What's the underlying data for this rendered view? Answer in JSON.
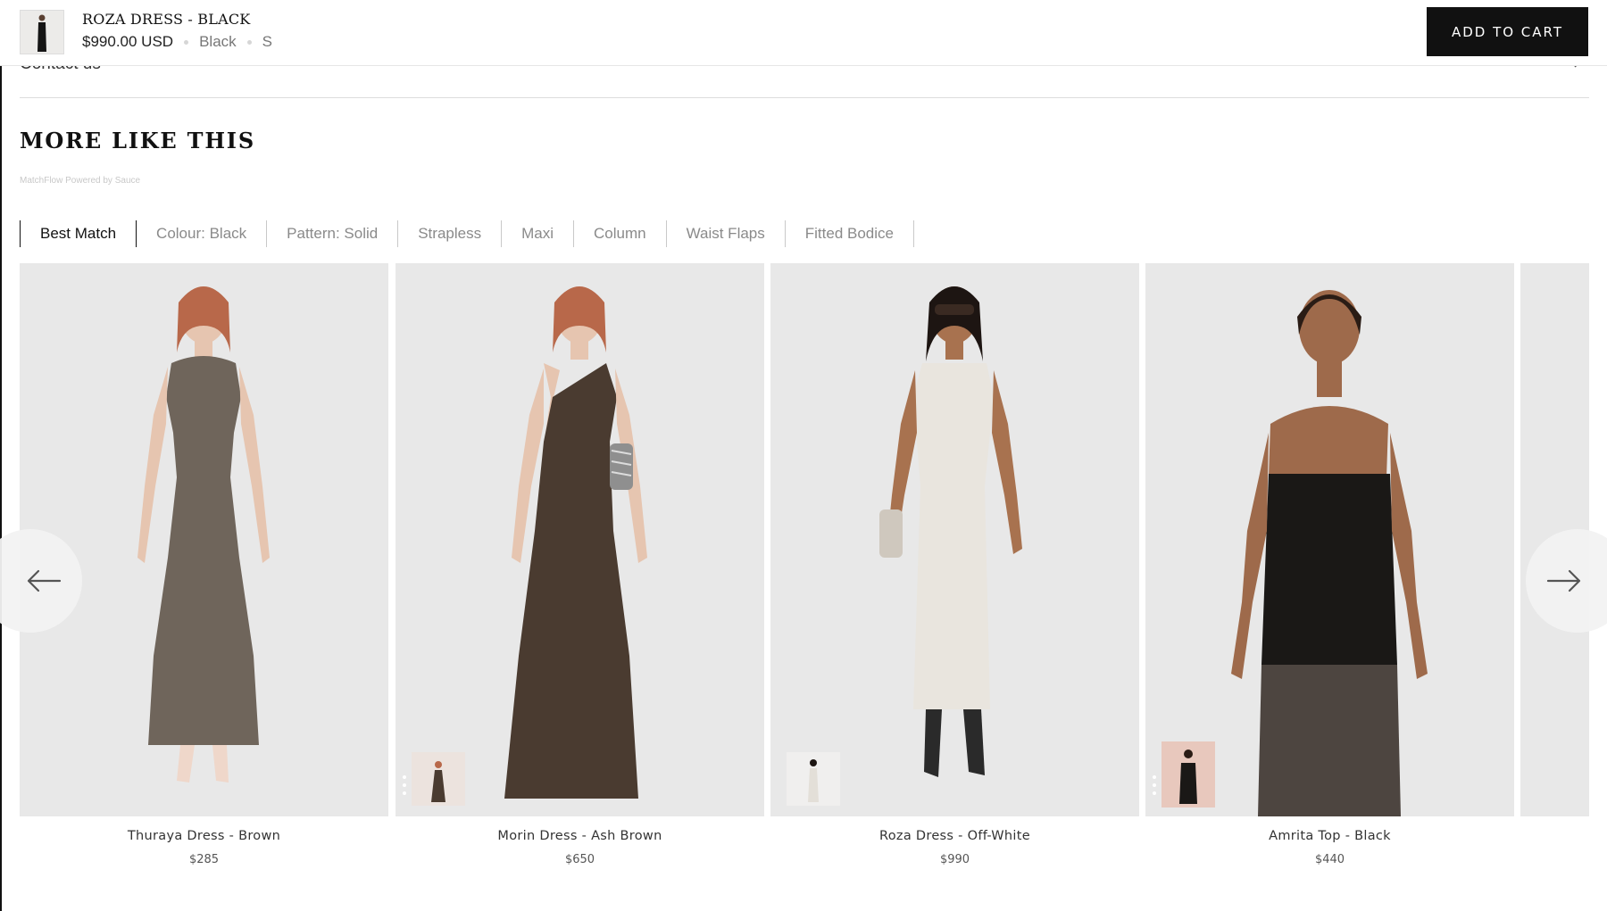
{
  "sticky_bar": {
    "title": "ROZA DRESS - BLACK",
    "price": "$990.00 USD",
    "colour": "Black",
    "size": "S",
    "add_to_cart_label": "ADD TO CART"
  },
  "contact_row": {
    "label": "Contact us",
    "icon": "chevron-right-icon"
  },
  "section": {
    "title": "MORE LIKE THIS",
    "powered_by": "MatchFlow Powered by Sauce"
  },
  "filters": [
    {
      "label": "Best Match",
      "active": true
    },
    {
      "label": "Colour: Black",
      "active": false
    },
    {
      "label": "Pattern: Solid",
      "active": false
    },
    {
      "label": "Strapless",
      "active": false
    },
    {
      "label": "Maxi",
      "active": false
    },
    {
      "label": "Column",
      "active": false
    },
    {
      "label": "Waist Flaps",
      "active": false
    },
    {
      "label": "Fitted Bodice",
      "active": false
    }
  ],
  "products": [
    {
      "name": "Thuraya Dress - Brown",
      "price": "$285"
    },
    {
      "name": "Morin Dress - Ash Brown",
      "price": "$650"
    },
    {
      "name": "Roza Dress - Off-White",
      "price": "$990"
    },
    {
      "name": "Amrita Top - Black",
      "price": "$440"
    }
  ],
  "carousel": {
    "prev_icon": "arrow-left-icon",
    "next_icon": "arrow-right-icon"
  },
  "colors": {
    "accent": "#111111",
    "card_bg": "#e8e8e8",
    "muted": "#8a8a8a"
  }
}
